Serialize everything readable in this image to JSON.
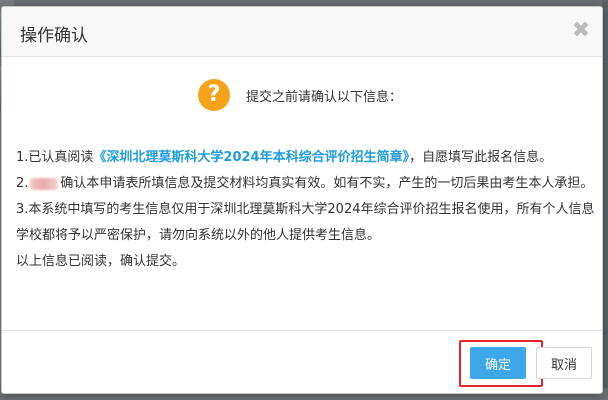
{
  "dialog": {
    "title": "操作确认",
    "close_symbol": "✖",
    "prompt": "提交之前请确认以下信息：",
    "help_symbol": "?"
  },
  "content": {
    "line1_prefix": "1.已认真阅读",
    "line1_link": "《深圳北理莫斯科大学2024年本科综合评价招生简章》",
    "line1_suffix": "，自愿填写此报名信息。",
    "line2_prefix": "2.",
    "line2_text": "确认本申请表所填信息及提交材料均真实有效。如有不实，产生的一切后果由考生本人承担。",
    "line3": "3.本系统中填写的考生信息仅用于深圳北理莫斯科大学2024年综合评价招生报名使用，所有个人信息学校都将予以严密保护，请勿向系统以外的他人提供考生信息。",
    "line4": "以上信息已阅读，确认提交。"
  },
  "footer": {
    "confirm_label": "确定",
    "cancel_label": "取消"
  },
  "colors": {
    "link": "#1e9ce0",
    "confirm_button": "#3ea7ea",
    "help_icon": "#f7a21b",
    "highlight": "#e8232b"
  },
  "icons": {
    "help": "question-circle-icon",
    "close": "close-icon"
  }
}
